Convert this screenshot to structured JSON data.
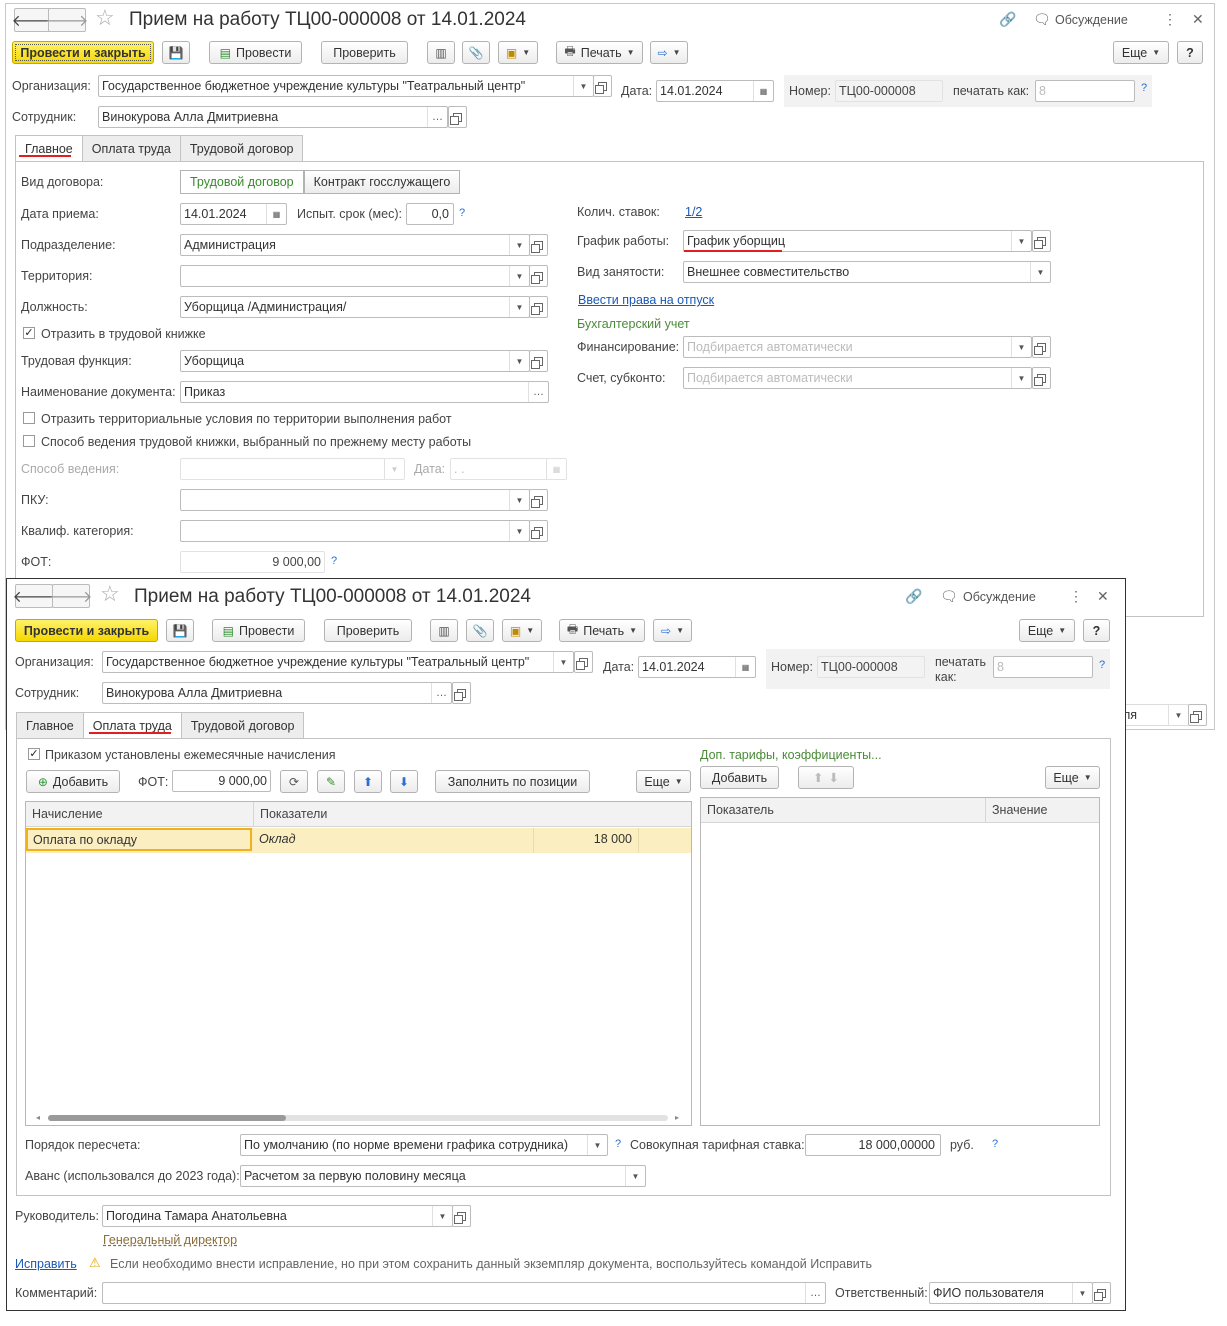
{
  "win1": {
    "title": "Прием на работу ТЦ00-000008 от 14.01.2024",
    "discussion": "Обсуждение",
    "toolbar": {
      "post_close": "Провести и закрыть",
      "post": "Провести",
      "check": "Проверить",
      "print": "Печать",
      "more": "Еще",
      "help": "?"
    },
    "org_label": "Организация:",
    "org_value": "Государственное бюджетное учреждение культуры \"Театральный центр\"",
    "date_label": "Дата:",
    "date_value": "14.01.2024",
    "number_label": "Номер:",
    "number_value": "ТЦ00-000008",
    "print_as_label": "печатать как:",
    "print_as_placeholder": "8",
    "employee_label": "Сотрудник:",
    "employee_value": "Винокурова Алла Дмитриевна",
    "tabs": [
      "Главное",
      "Оплата труда",
      "Трудовой договор"
    ],
    "contract_type_label": "Вид договора:",
    "contract_options": [
      "Трудовой договор",
      "Контракт госслужащего"
    ],
    "hire_date_label": "Дата приема:",
    "hire_date_value": "14.01.2024",
    "probation_label": "Испыт. срок (мес):",
    "probation_value": "0,0",
    "dept_label": "Подразделение:",
    "dept_value": "Администрация",
    "territory_label": "Территория:",
    "position_label": "Должность:",
    "position_value": "Уборщица /Администрация/",
    "reflect_book": "Отразить в трудовой книжке",
    "labor_func_label": "Трудовая функция:",
    "labor_func_value": "Уборщица",
    "doc_name_label": "Наименование документа:",
    "doc_name_value": "Приказ",
    "terr_conditions": "Отразить территориальные условия по территории выполнения работ",
    "book_method": "Способ ведения трудовой книжки, выбранный по прежнему месту работы",
    "method_label": "Способ ведения:",
    "date2_label": "Дата:",
    "date2_value": " .  .",
    "pku_label": "ПКУ:",
    "qual_label": "Квалиф. категория:",
    "fot_label": "ФОТ:",
    "fot_value": "9 000,00",
    "rates_label": "Колич. ставок:",
    "rates_value": "1/2",
    "schedule_label": "График работы:",
    "schedule_value": "График уборщиц",
    "employment_label": "Вид занятости:",
    "employment_value": "Внешнее совместительство",
    "vacation_link": "Ввести права на отпуск",
    "accounting_label": "Бухгалтерский учет",
    "financing_label": "Финансирование:",
    "auto_placeholder": "Подбирается автоматически",
    "account_label": "Счет, субконто:"
  },
  "win2": {
    "title": "Прием на работу ТЦ00-000008 от 14.01.2024",
    "discussion": "Обсуждение",
    "toolbar": {
      "post_close": "Провести и закрыть",
      "post": "Провести",
      "check": "Проверить",
      "print": "Печать",
      "more": "Еще",
      "help": "?"
    },
    "org_label": "Организация:",
    "org_value": "Государственное бюджетное учреждение культуры \"Театральный центр\"",
    "date_label": "Дата:",
    "date_value": "14.01.2024",
    "number_label": "Номер:",
    "number_value": "ТЦ00-000008",
    "print_as_label_1": "печатать",
    "print_as_label_2": "как:",
    "print_as_placeholder": "8",
    "employee_label": "Сотрудник:",
    "employee_value": "Винокурова Алла Дмитриевна",
    "tabs": [
      "Главное",
      "Оплата труда",
      "Трудовой договор"
    ],
    "monthly_accruals": "Приказом установлены ежемесячные начисления",
    "extra_tariffs": "Доп. тарифы, коэффициенты...",
    "add": "Добавить",
    "fot_label": "ФОТ:",
    "fot_value": "9 000,00",
    "fill_by_position": "Заполнить по позиции",
    "more": "Еще",
    "grid1_headers": [
      "Начисление",
      "Показатели"
    ],
    "grid1_rows": [
      {
        "accrual": "Оплата по окладу",
        "indicator": "Оклад",
        "value": "18 000"
      }
    ],
    "grid2_headers": [
      "Показатель",
      "Значение"
    ],
    "recalc_label": "Порядок пересчета:",
    "recalc_value": "По умолчанию (по норме времени графика сотрудника)",
    "total_rate_label": "Совокупная тарифная ставка:",
    "total_rate_value": "18 000,00000",
    "currency": "руб.",
    "advance_label": "Аванс (использовался до 2023 года):",
    "advance_value": "Расчетом за первую половину месяца",
    "manager_label": "Руководитель:",
    "manager_value": "Погодина Тамара Анатольевна",
    "manager_position": "Генеральный директор",
    "fix_link": "Исправить",
    "fix_note": "Если необходимо внести исправление, но при этом сохранить данный экземпляр документа, воспользуйтесь командой Исправить",
    "comment_label": "Комментарий:",
    "responsible_label": "Ответственный:",
    "responsible_value": "ФИО пользователя",
    "bg_fragment": "ля"
  }
}
